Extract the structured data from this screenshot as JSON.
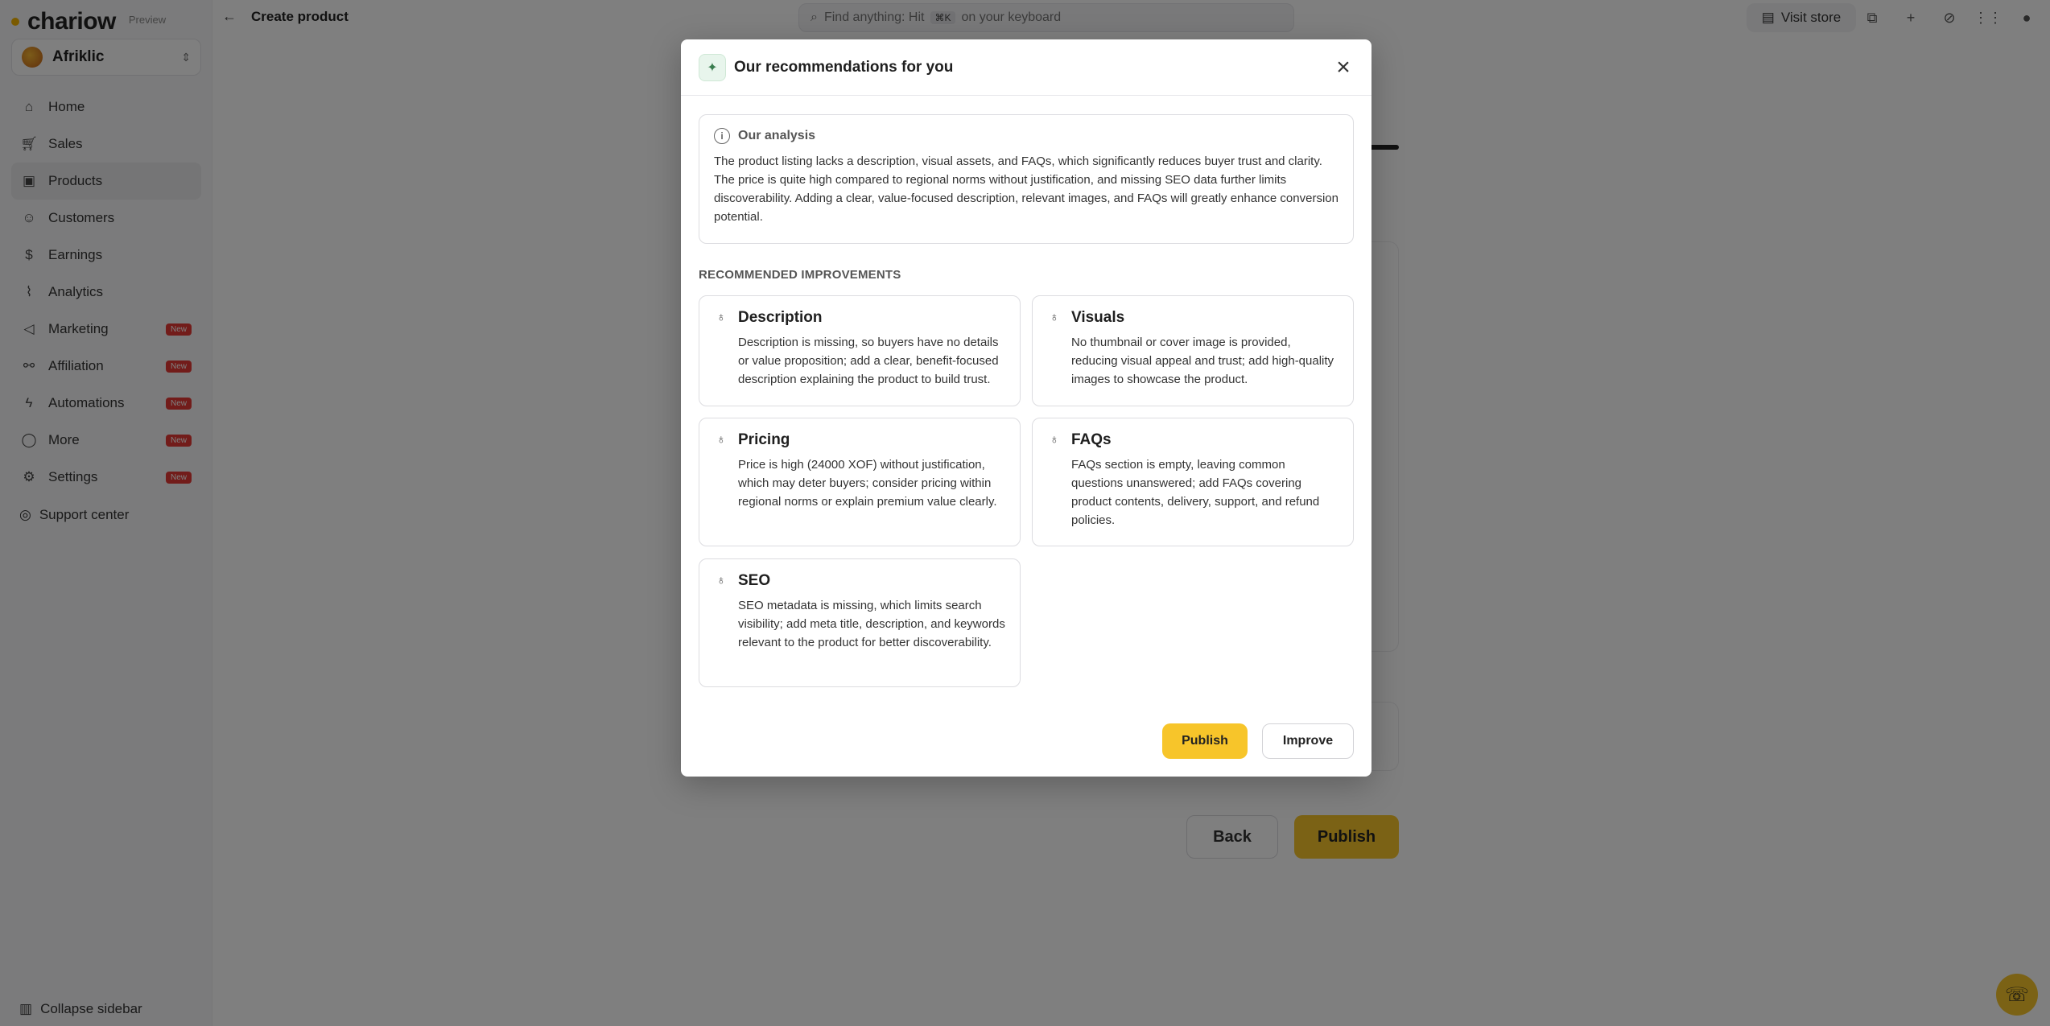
{
  "app": {
    "brand": "chariow",
    "brand_badge": "Preview",
    "store_name": "Afriklic"
  },
  "sidebar": {
    "items": [
      {
        "label": "Home",
        "icon": "home-icon",
        "badge": ""
      },
      {
        "label": "Sales",
        "icon": "cart-icon",
        "badge": ""
      },
      {
        "label": "Products",
        "icon": "box-icon",
        "badge": "",
        "active": true
      },
      {
        "label": "Customers",
        "icon": "users-icon",
        "badge": ""
      },
      {
        "label": "Earnings",
        "icon": "dollar-icon",
        "badge": ""
      },
      {
        "label": "Analytics",
        "icon": "chart-icon",
        "badge": ""
      },
      {
        "label": "Marketing",
        "icon": "megaphone-icon",
        "badge": "New"
      },
      {
        "label": "Affiliation",
        "icon": "share-icon",
        "badge": "New"
      },
      {
        "label": "Automations",
        "icon": "bolt-icon",
        "badge": "New"
      },
      {
        "label": "More",
        "icon": "more-icon",
        "badge": "New"
      },
      {
        "label": "Settings",
        "icon": "gear-icon",
        "badge": "New"
      }
    ],
    "support_label": "Support center",
    "collapse_label": "Collapse sidebar"
  },
  "topbar": {
    "page_title": "Create product",
    "search_placeholder_pre": "Find anything: Hit",
    "search_kbd": "⌘K",
    "search_placeholder_post": "on your keyboard",
    "visit_store_label": "Visit store"
  },
  "page": {
    "back_label": "Back",
    "publish_label": "Publish"
  },
  "modal": {
    "title": "Our recommendations for you",
    "analysis_title": "Our analysis",
    "analysis_text": "The product listing lacks a description, visual assets, and FAQs, which significantly reduces buyer trust and clarity. The price is quite high compared to regional norms without justification, and missing SEO data further limits discoverability. Adding a clear, value-focused description, relevant images, and FAQs will greatly enhance conversion potential.",
    "recommendations_heading": "RECOMMENDED IMPROVEMENTS",
    "recommendations": [
      {
        "title": "Description",
        "text": "Description is missing, so buyers have no details or value proposition; add a clear, benefit-focused description explaining the product to build trust."
      },
      {
        "title": "Visuals",
        "text": "No thumbnail or cover image is provided, reducing visual appeal and trust; add high-quality images to showcase the product."
      },
      {
        "title": "Pricing",
        "text": "Price is high (24000 XOF) without justification, which may deter buyers; consider pricing within regional norms or explain premium value clearly."
      },
      {
        "title": "FAQs",
        "text": "FAQs section is empty, leaving common questions unanswered; add FAQs covering product contents, delivery, support, and refund policies."
      },
      {
        "title": "SEO",
        "text": "SEO metadata is missing, which limits search visibility; add meta title, description, and keywords relevant to the product for better discoverability."
      }
    ],
    "publish_label": "Publish",
    "improve_label": "Improve"
  },
  "colors": {
    "accent": "#f7c52a",
    "badge": "#e53935",
    "overlay": "rgba(0,0,0,0.5)"
  }
}
